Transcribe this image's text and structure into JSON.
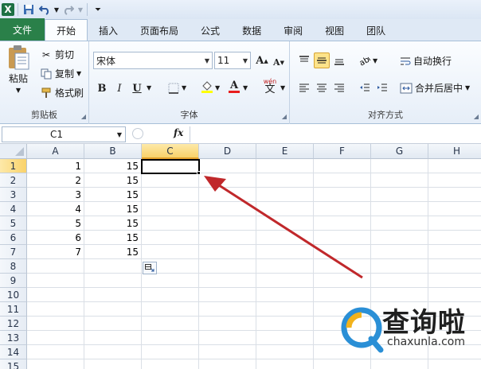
{
  "qat": {
    "logo": "X",
    "save_icon": "save-icon",
    "undo_icon": "undo-icon",
    "redo_icon": "redo-icon"
  },
  "tabs": [
    {
      "label": "文件"
    },
    {
      "label": "开始"
    },
    {
      "label": "插入"
    },
    {
      "label": "页面布局"
    },
    {
      "label": "公式"
    },
    {
      "label": "数据"
    },
    {
      "label": "审阅"
    },
    {
      "label": "视图"
    },
    {
      "label": "团队"
    }
  ],
  "ribbon": {
    "clipboard": {
      "paste": "粘贴",
      "cut": "剪切",
      "copy": "复制",
      "format_painter": "格式刷",
      "label": "剪贴板"
    },
    "font": {
      "name": "宋体",
      "size": "11",
      "bold": "B",
      "italic": "I",
      "underline": "U",
      "grow": "A",
      "shrink": "A",
      "font_color": "A",
      "phonetic_top": "wén",
      "phonetic_bottom": "文",
      "label": "字体"
    },
    "alignment": {
      "wrap_text": "自动换行",
      "merge_center": "合并后居中",
      "label": "对齐方式"
    }
  },
  "formula_bar": {
    "name_box": "C1",
    "fx": "fx",
    "value": ""
  },
  "columns": [
    "A",
    "B",
    "C",
    "D",
    "E",
    "F",
    "G",
    "H"
  ],
  "selected_column": "C",
  "rows": [
    "1",
    "2",
    "3",
    "4",
    "5",
    "6",
    "7",
    "8",
    "9",
    "10",
    "11",
    "12",
    "13",
    "14",
    "15"
  ],
  "selected_row": "1",
  "cells": {
    "A": [
      "1",
      "2",
      "3",
      "4",
      "5",
      "6",
      "7"
    ],
    "B": [
      "15",
      "15",
      "15",
      "15",
      "15",
      "15",
      "15"
    ]
  },
  "annotation": {
    "arrow_color": "#c0282b"
  },
  "watermark": {
    "brand": "查询啦",
    "url": "chaxunla.com"
  }
}
